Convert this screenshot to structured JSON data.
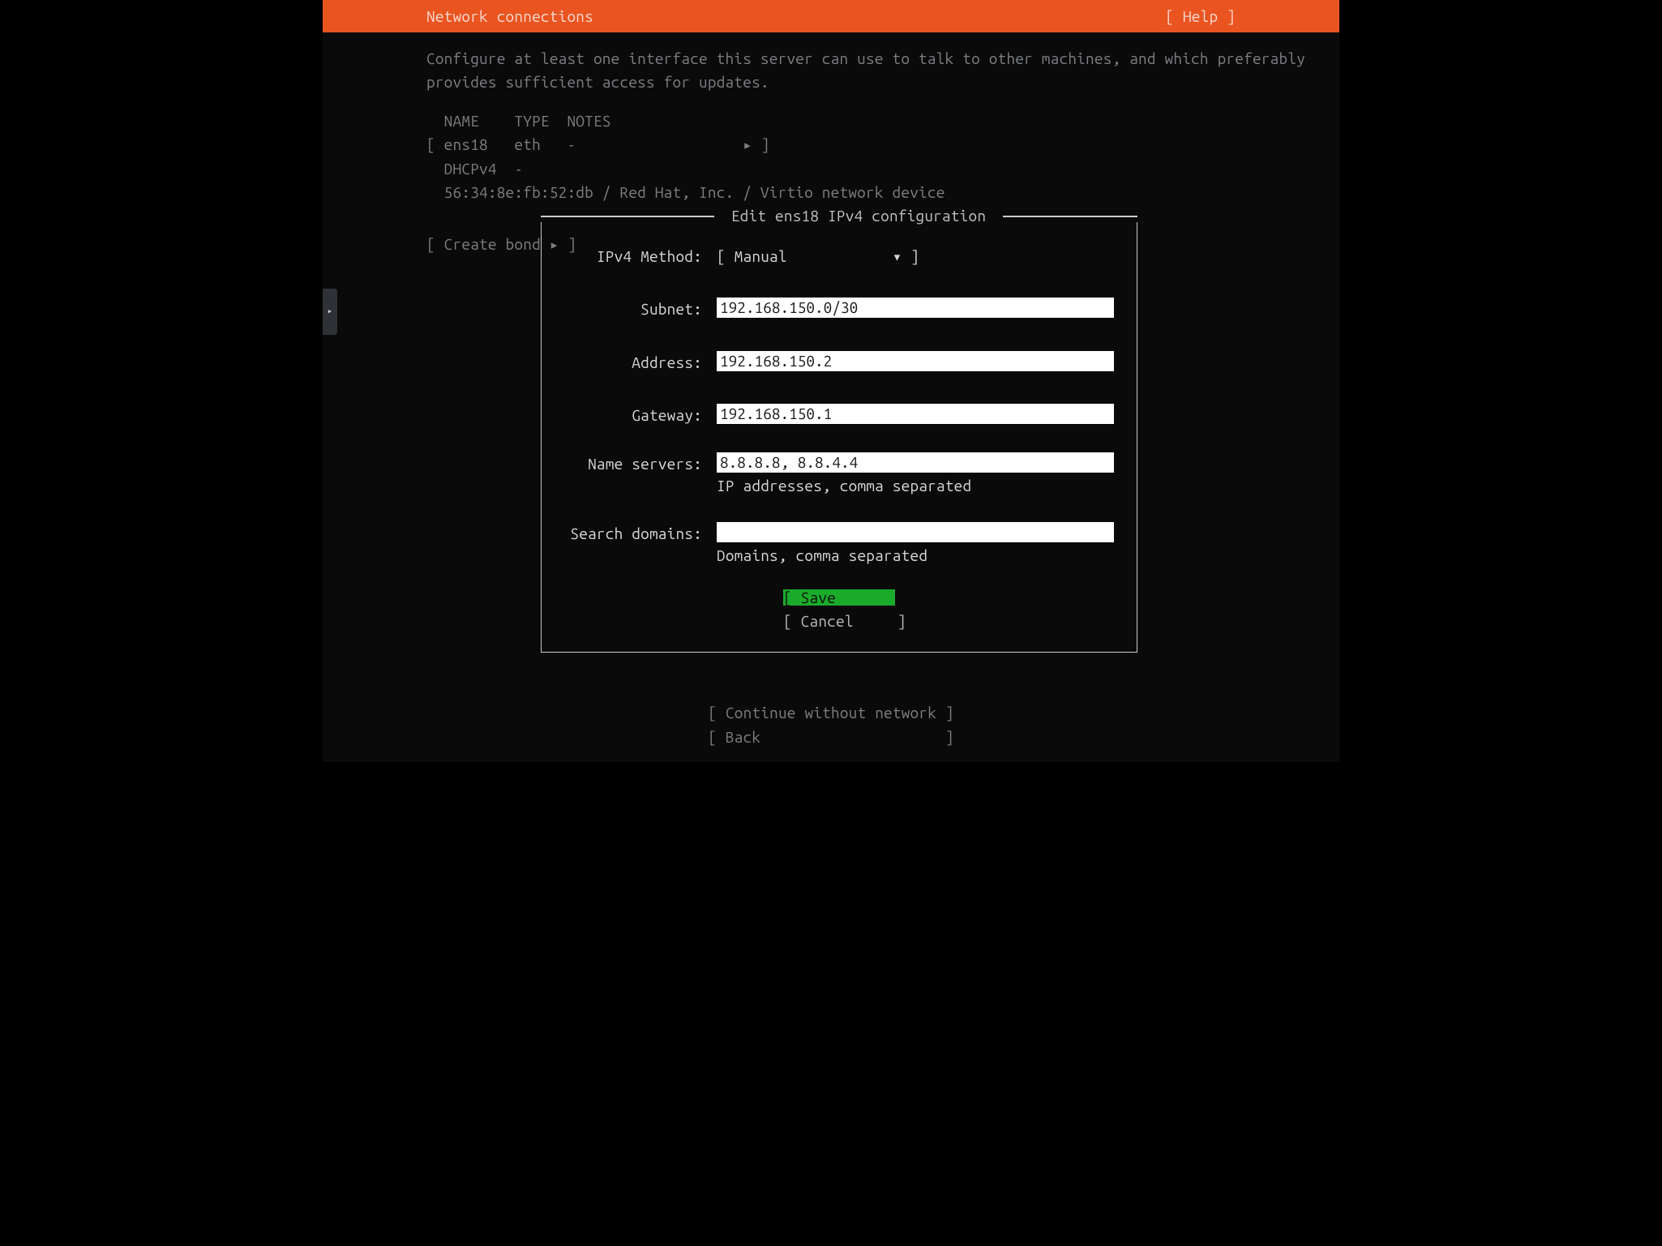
{
  "header": {
    "title": "Network connections",
    "help_label": "[ Help ]"
  },
  "description": "Configure at least one interface this server can use to talk to other machines, and which preferably\nprovides sufficient access for updates.",
  "interfaces": {
    "row_text": "  NAME    TYPE  NOTES\n[ ens18   eth   -                   ▸ ]\n  DHCPv4  -\n  56:34:8e:fb:52:db / Red Hat, Inc. / Virtio network device"
  },
  "create_bond_label": "[ Create bond ▸ ]",
  "dialog": {
    "title": " Edit ens18 IPv4 configuration ",
    "method_label": "IPv4 Method:",
    "method_display": "[ Manual            ▾ ]",
    "fields": {
      "subnet": {
        "label": "Subnet:",
        "value": "192.168.150.0/30"
      },
      "address": {
        "label": "Address:",
        "value": "192.168.150.2"
      },
      "gateway": {
        "label": "Gateway:",
        "value": "192.168.150.1"
      },
      "ns": {
        "label": "Name servers:",
        "value": "8.8.8.8, 8.8.4.4",
        "hint": "IP addresses, comma separated"
      },
      "domains": {
        "label": "Search domains:",
        "value": "",
        "hint": "Domains, comma separated"
      }
    },
    "buttons": {
      "save": "[ Save       ]",
      "cancel": "[ Cancel     ]"
    }
  },
  "footer": {
    "continue_label": "[ Continue without network ]",
    "back_label": "[ Back                     ]"
  },
  "side_tab_glyph": "▸"
}
